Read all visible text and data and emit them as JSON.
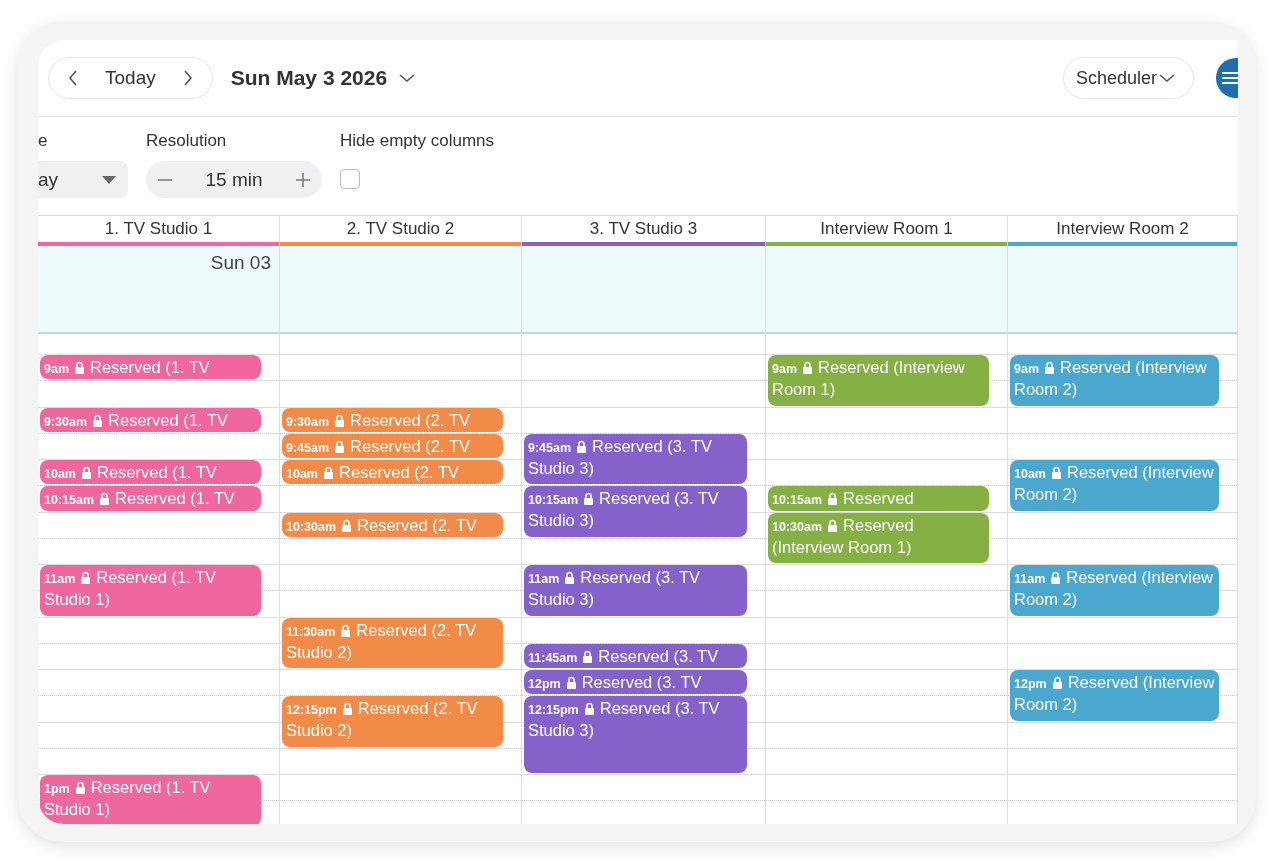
{
  "toolbar": {
    "today": "Today",
    "date": "Sun May 3 2026",
    "view": "Scheduler"
  },
  "filters": [
    {
      "kind": "select",
      "label": "e",
      "value": "ay"
    },
    {
      "kind": "stepper",
      "label": "Resolution",
      "value": "15 min"
    },
    {
      "kind": "checkbox",
      "label": "Hide empty columns",
      "checked": false
    }
  ],
  "allday_label": "Sun 03",
  "columns": [
    {
      "name": "1. TV Studio 1",
      "color": "#f0679e",
      "slots": [
        {
          "kind": "event",
          "time": "9am",
          "title": "Reserved (1. TV"
        },
        {
          "kind": "empty"
        },
        {
          "kind": "event",
          "time": "9:30am",
          "title": "Reserved (1. TV"
        },
        {
          "kind": "empty"
        },
        {
          "kind": "event",
          "time": "10am",
          "title": "Reserved (1. TV"
        },
        {
          "kind": "event",
          "time": "10:15am",
          "title": "Reserved (1. TV"
        },
        {
          "kind": "empty"
        },
        {
          "kind": "empty"
        },
        {
          "kind": "event",
          "time": "11am",
          "title": "Reserved (1. TV Studio 1)"
        },
        {
          "kind": "continued"
        },
        {
          "kind": "empty"
        },
        {
          "kind": "empty"
        },
        {
          "kind": "empty"
        },
        {
          "kind": "empty"
        },
        {
          "kind": "empty"
        },
        {
          "kind": "empty"
        },
        {
          "kind": "event",
          "time": "1pm",
          "title": "Reserved (1. TV Studio 1)"
        },
        {
          "kind": "continued"
        }
      ]
    },
    {
      "name": "2. TV Studio 2",
      "color": "#f28b47",
      "slots": [
        {
          "kind": "empty"
        },
        {
          "kind": "empty"
        },
        {
          "kind": "event",
          "time": "9:30am",
          "title": "Reserved (2. TV"
        },
        {
          "kind": "event",
          "time": "9:45am",
          "title": "Reserved (2. TV"
        },
        {
          "kind": "event",
          "time": "10am",
          "title": "Reserved (2. TV"
        },
        {
          "kind": "empty"
        },
        {
          "kind": "event",
          "time": "10:30am",
          "title": "Reserved (2. TV"
        },
        {
          "kind": "empty"
        },
        {
          "kind": "empty"
        },
        {
          "kind": "empty"
        },
        {
          "kind": "event",
          "time": "11:30am",
          "title": "Reserved (2. TV Studio 2)"
        },
        {
          "kind": "continued"
        },
        {
          "kind": "empty"
        },
        {
          "kind": "event",
          "time": "12:15pm",
          "title": "Reserved (2. TV Studio 2)"
        },
        {
          "kind": "continued"
        }
      ]
    },
    {
      "name": "3. TV Studio 3",
      "color": "#8462c9",
      "slots": [
        {
          "kind": "empty"
        },
        {
          "kind": "empty"
        },
        {
          "kind": "empty"
        },
        {
          "kind": "event",
          "time": "9:45am",
          "title": "Reserved (3. TV Studio 3)"
        },
        {
          "kind": "continued"
        },
        {
          "kind": "event",
          "time": "10:15am",
          "title": "Reserved (3. TV Studio 3)"
        },
        {
          "kind": "continued"
        },
        {
          "kind": "empty"
        },
        {
          "kind": "event",
          "time": "11am",
          "title": "Reserved (3. TV Studio 3)"
        },
        {
          "kind": "continued"
        },
        {
          "kind": "empty"
        },
        {
          "kind": "event",
          "time": "11:45am",
          "title": "Reserved (3. TV"
        },
        {
          "kind": "event",
          "time": "12pm",
          "title": "Reserved (3. TV"
        },
        {
          "kind": "event",
          "time": "12:15pm",
          "title": "Reserved (3. TV Studio 3)"
        },
        {
          "kind": "continued"
        },
        {
          "kind": "continued"
        }
      ]
    },
    {
      "name": "Interview Room 1",
      "color": "#84b044",
      "slots": [
        {
          "kind": "event",
          "time": "9am",
          "title": "Reserved (Interview Room 1)"
        },
        {
          "kind": "continued"
        },
        {
          "kind": "empty"
        },
        {
          "kind": "empty"
        },
        {
          "kind": "empty"
        },
        {
          "kind": "event",
          "time": "10:15am",
          "title": "Reserved"
        },
        {
          "kind": "event",
          "time": "10:30am",
          "title": "Reserved (Interview Room 1)"
        },
        {
          "kind": "continued"
        }
      ]
    },
    {
      "name": "Interview Room 2",
      "color": "#4aa8cf",
      "slots": [
        {
          "kind": "event",
          "time": "9am",
          "title": "Reserved (Interview Room 2)"
        },
        {
          "kind": "continued"
        },
        {
          "kind": "empty"
        },
        {
          "kind": "empty"
        },
        {
          "kind": "event",
          "time": "10am",
          "title": "Reserved (Interview Room 2)"
        },
        {
          "kind": "continued"
        },
        {
          "kind": "empty"
        },
        {
          "kind": "empty"
        },
        {
          "kind": "event",
          "time": "11am",
          "title": "Reserved (Interview Room 2)"
        },
        {
          "kind": "continued"
        },
        {
          "kind": "empty"
        },
        {
          "kind": "empty"
        },
        {
          "kind": "event",
          "time": "12pm",
          "title": "Reserved (Interview Room 2)"
        },
        {
          "kind": "continued"
        }
      ]
    }
  ]
}
